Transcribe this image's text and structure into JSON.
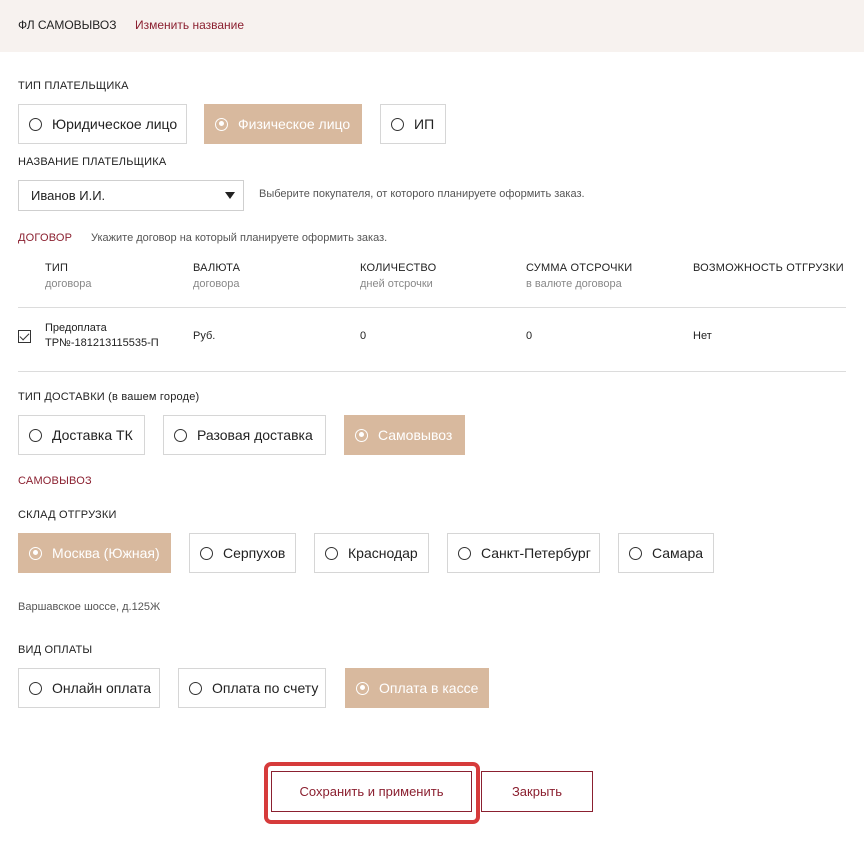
{
  "header": {
    "title": "ФЛ САМОВЫВОЗ",
    "rename_link": "Изменить название"
  },
  "payer_type": {
    "label": "ТИП ПЛАТЕЛЬЩИКА",
    "options": [
      "Юридическое лицо",
      "Физическое лицо",
      "ИП"
    ],
    "selected": "Физическое лицо"
  },
  "payer_name": {
    "label": "НАЗВАНИЕ ПЛАТЕЛЬЩИКА",
    "value": "Иванов И.И.",
    "hint": "Выберите покупателя, от которого планируете оформить заказ."
  },
  "contract": {
    "label": "ДОГОВОР",
    "hint": "Укажите договор на который планируете оформить заказ.",
    "columns": [
      {
        "title": "ТИП",
        "sub": "договора"
      },
      {
        "title": "ВАЛЮТА",
        "sub": "договора"
      },
      {
        "title": "КОЛИЧЕСТВО",
        "sub": "дней отсрочки"
      },
      {
        "title": "СУММА ОТСРОЧКИ",
        "sub": "в валюте договора"
      },
      {
        "title": "ВОЗМОЖНОСТЬ ОТГРУЗКИ",
        "sub": ""
      }
    ],
    "rows": [
      {
        "checked": true,
        "type_line1": "Предоплата",
        "type_line2": "ТР№-181213115535-П",
        "currency": "Руб.",
        "days": "0",
        "sum": "0",
        "shipment": "Нет"
      }
    ]
  },
  "delivery_type": {
    "label": "ТИП ДОСТАВКИ (в вашем городе)",
    "options": [
      "Доставка ТК",
      "Разовая доставка",
      "Самовывоз"
    ],
    "selected": "Самовывоз"
  },
  "pickup": {
    "label": "САМОВЫВОЗ"
  },
  "warehouse": {
    "label": "СКЛАД ОТГРУЗКИ",
    "options": [
      "Москва (Южная)",
      "Серпухов",
      "Краснодар",
      "Санкт-Петербург",
      "Самара"
    ],
    "selected": "Москва (Южная)",
    "address": "Варшавское шоссе, д.125Ж"
  },
  "payment_type": {
    "label": "ВИД ОПЛАТЫ",
    "options": [
      "Онлайн оплата",
      "Оплата по счету",
      "Оплата в кассе"
    ],
    "selected": "Оплата в кассе"
  },
  "actions": {
    "save_label": "Сохранить и применить",
    "close_label": "Закрыть"
  },
  "colors": {
    "accent": "#8b2030",
    "selected_bg": "#d8b99e",
    "highlight": "#d63b3b",
    "header_bg": "#f7f2ef"
  }
}
